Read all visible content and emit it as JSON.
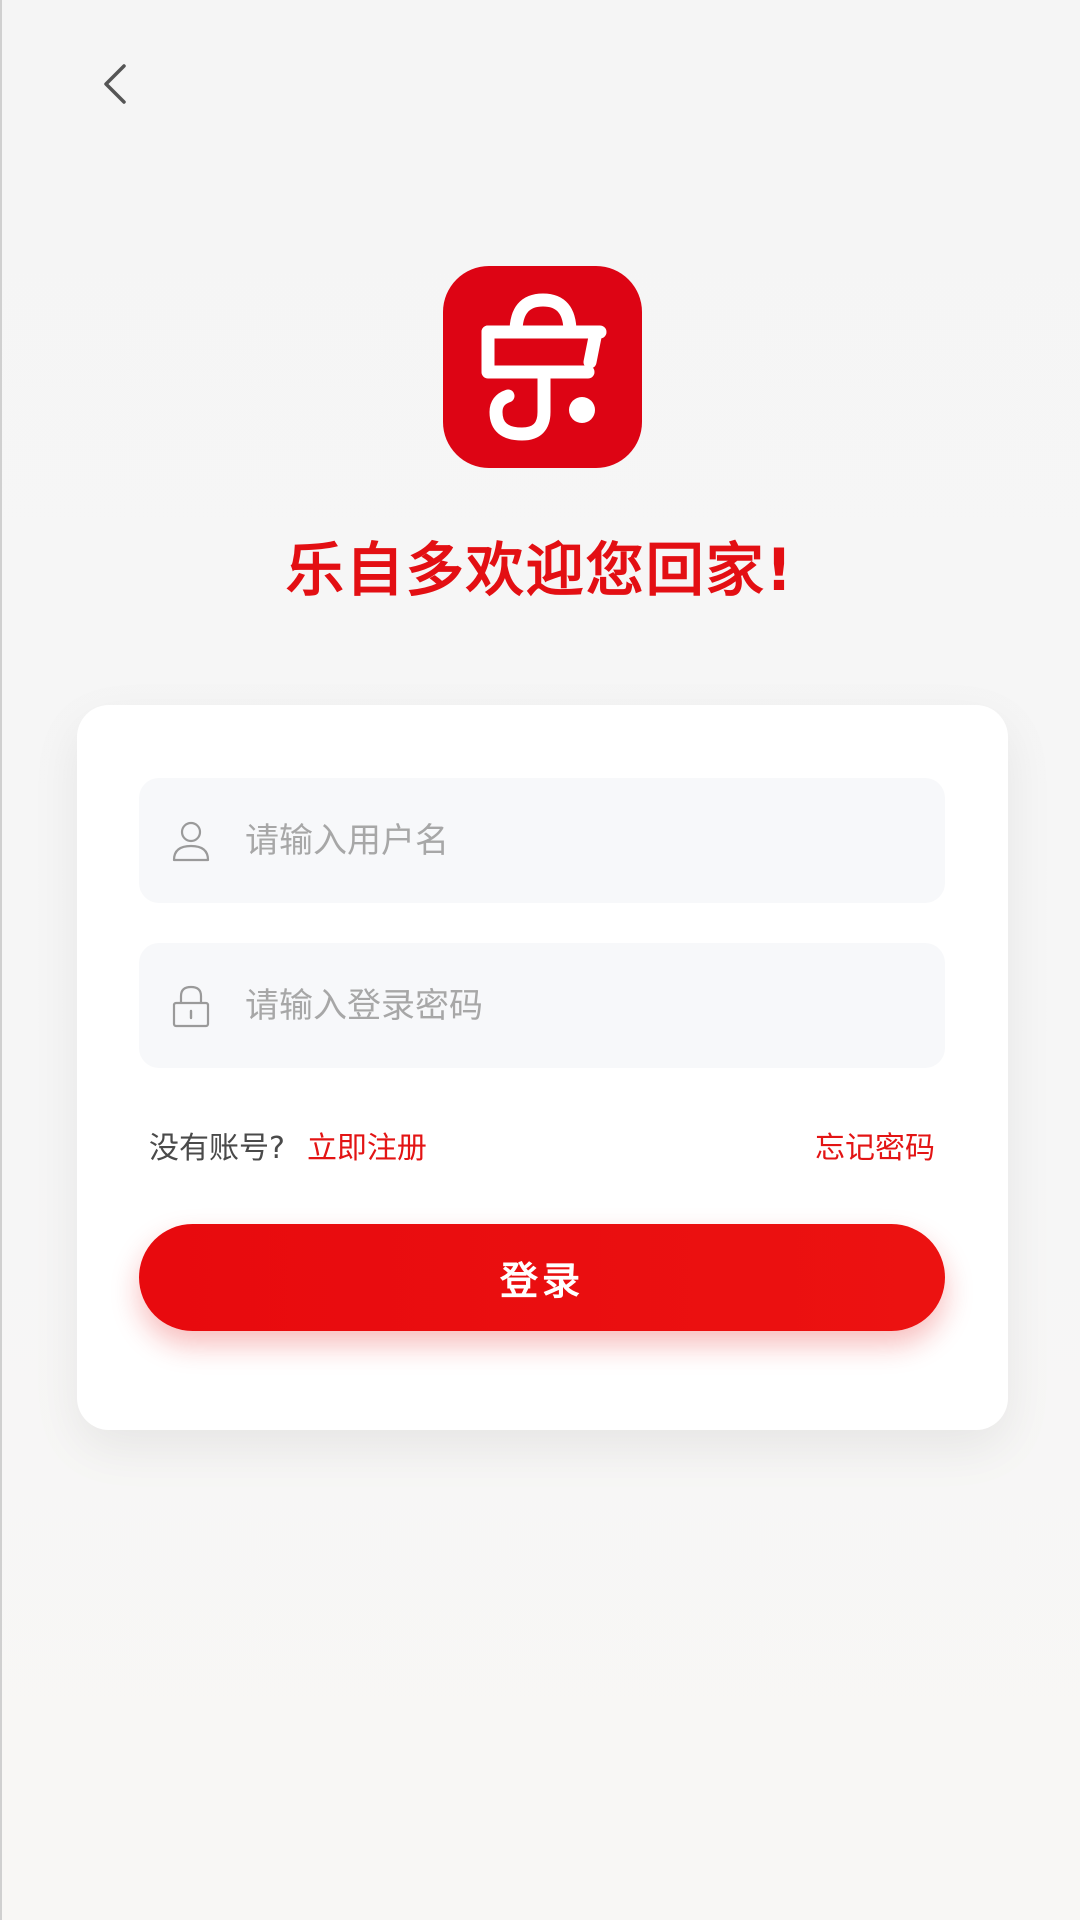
{
  "header": {
    "back_icon": "chevron-left-icon"
  },
  "brand": {
    "logo_icon": "shopping-bag-le-logo-icon",
    "logo_color": "#dd0414",
    "welcome_text": "乐自多欢迎您回家!"
  },
  "form": {
    "username_placeholder": "请输入用户名",
    "username_value": "",
    "username_icon": "user-icon",
    "password_placeholder": "请输入登录密码",
    "password_value": "",
    "password_icon": "lock-icon",
    "no_account_text": "没有账号?",
    "register_label": "立即注册",
    "forgot_label": "忘记密码",
    "login_label": "登录"
  },
  "colors": {
    "accent": "#e30f13",
    "background": "#f5f5f5",
    "card": "#ffffff",
    "field_bg": "#f7f8fa"
  }
}
